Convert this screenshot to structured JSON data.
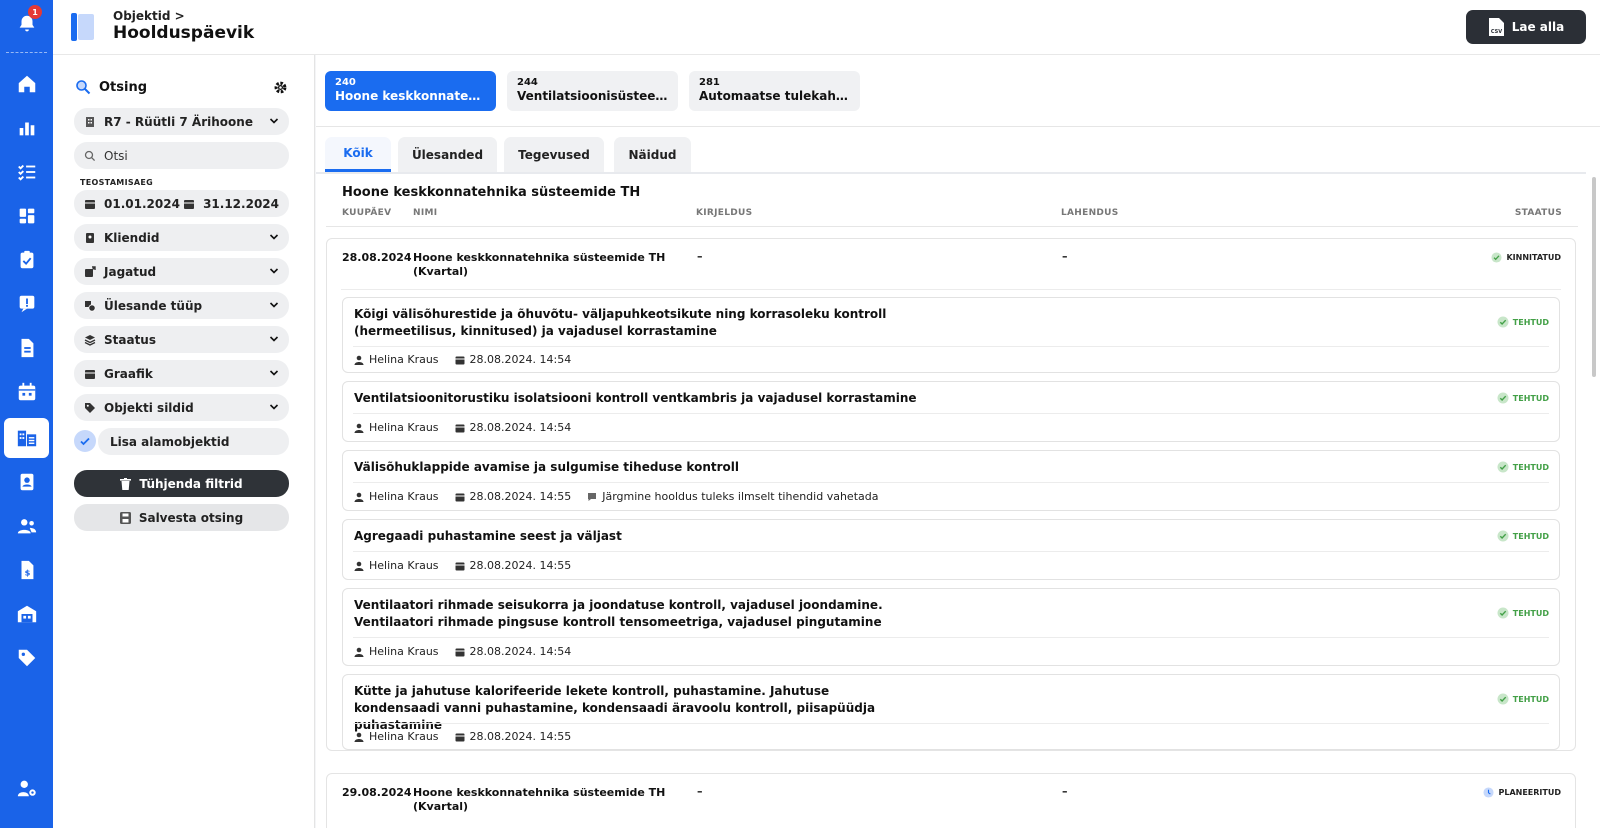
{
  "rail": {
    "notification_count": "1",
    "items": [
      "bell-icon",
      "home-icon",
      "chart-icon",
      "checklist-icon",
      "dashboard-icon",
      "clipboard-icon",
      "alert-icon",
      "document-icon",
      "calendar-icon",
      "building-icon",
      "contacts-icon",
      "users-icon",
      "invoice-icon",
      "warehouse-icon",
      "tag-icon",
      "user-settings-icon"
    ],
    "active": "building-icon",
    "color": "#1a63e8"
  },
  "header": {
    "breadcrumb": "Objektid >",
    "title": "Hoolduspäevik",
    "download_label": "Lae alla",
    "download_icon": "csv-file-icon"
  },
  "filters": {
    "title": "Otsing",
    "object_select": "R7 - Rüütli 7 Ärihoone",
    "search_placeholder": "Otsi",
    "date_label": "TEOSTAMISAEG",
    "date_from": "01.01.2024",
    "date_to": "31.12.2024",
    "dropdowns": [
      "Kliendid",
      "Jagatud",
      "Ülesande tüüp",
      "Staatus",
      "Graafik",
      "Objekti sildid"
    ],
    "include_sub": "Lisa alamobjektid",
    "clear_label": "Tühjenda filtrid",
    "save_label": "Salvesta otsing"
  },
  "objects": [
    {
      "num": "240",
      "name": "Hoone keskkonnatehnika süsteemide TH",
      "active": true
    },
    {
      "num": "244",
      "name": "Ventilatsioonisüsteemide TH",
      "active": false
    },
    {
      "num": "281",
      "name": "Automaatse tulekahjusignalisatsiooni TH",
      "active": false
    }
  ],
  "tabs": [
    "Kõik",
    "Ülesanded",
    "Tegevused",
    "Näidud"
  ],
  "active_tab": "Kõik",
  "section_title": "Hoone keskkonnatehnika süsteemide TH",
  "columns": {
    "date": "KUUPÄEV",
    "name": "NIMI",
    "desc": "KIRJELDUS",
    "solution": "LAHENDUS",
    "status": "STAATUS"
  },
  "groups": [
    {
      "date": "28.08.2024",
      "name": "Hoone keskkonnatehnika süsteemide TH (Kvartal)",
      "desc": "–",
      "solution": "–",
      "status": "KINNITATUD",
      "tasks": [
        {
          "title": "Kõigi välisõhurestide ja õhuvõtu- väljapuhkeotsikute ning korrasoleku kontroll (hermeetilisus, kinnitused) ja vajadusel korrastamine",
          "status": "TEHTUD",
          "user": "Helina Kraus",
          "time": "28.08.2024. 14:54",
          "comment": ""
        },
        {
          "title": "Ventilatsioonitorustiku isolatsiooni kontroll ventkambris ja vajadusel korrastamine",
          "status": "TEHTUD",
          "user": "Helina Kraus",
          "time": "28.08.2024. 14:54",
          "comment": ""
        },
        {
          "title": "Välisõhuklappide avamise ja sulgumise tiheduse kontroll",
          "status": "TEHTUD",
          "user": "Helina Kraus",
          "time": "28.08.2024. 14:55",
          "comment": "Järgmine hooldus tuleks ilmselt tihendid vahetada"
        },
        {
          "title": "Agregaadi puhastamine seest ja väljast",
          "status": "TEHTUD",
          "user": "Helina Kraus",
          "time": "28.08.2024. 14:55",
          "comment": ""
        },
        {
          "title": "Ventilaatori rihmade seisukorra ja joondatuse kontroll, vajadusel joondamine. Ventilaatori rihmade pingsuse kontroll tensomeetriga, vajadusel pingutamine",
          "status": "TEHTUD",
          "user": "Helina Kraus",
          "time": "28.08.2024. 14:54",
          "comment": ""
        },
        {
          "title": "Kütte ja jahutuse kalorifeeride lekete kontroll, puhastamine. Jahutuse kondensaadi vanni puhastamine, kondensaadi äravoolu kontroll, piisapüüdja puhastamine",
          "status": "TEHTUD",
          "user": "Helina Kraus",
          "time": "28.08.2024. 14:55",
          "comment": ""
        }
      ]
    },
    {
      "date": "29.08.2024",
      "name": "Hoone keskkonnatehnika süsteemide TH (Kvartal)",
      "desc": "–",
      "solution": "–",
      "status": "PLANEERITUD",
      "tasks": []
    }
  ],
  "colors": {
    "accent": "#1a6cf0",
    "done": "#43a047",
    "confirmed_icon": "#66bb6a",
    "planned_icon": "#9ab6f0"
  }
}
